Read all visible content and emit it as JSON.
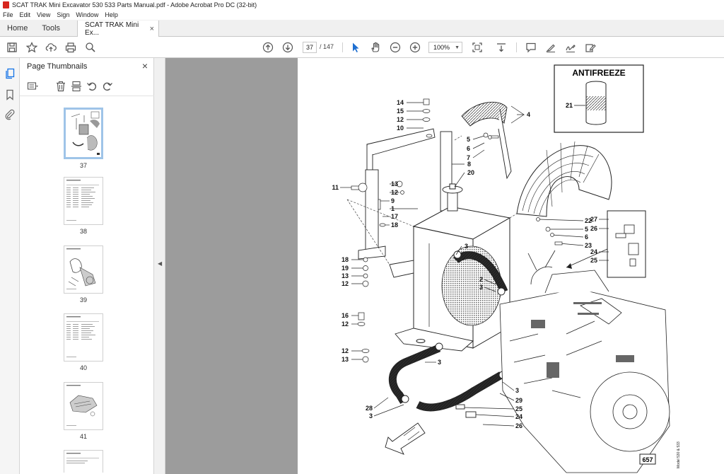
{
  "window": {
    "title": "SCAT TRAK Mini Excavator 530 533 Parts Manual.pdf - Adobe Acrobat Pro DC (32-bit)"
  },
  "menu": [
    "File",
    "Edit",
    "View",
    "Sign",
    "Window",
    "Help"
  ],
  "tabs": {
    "home": "Home",
    "tools": "Tools",
    "document": "SCAT TRAK Mini Ex...",
    "close": "×"
  },
  "toolbar": {
    "icons": [
      "save-icon",
      "star-icon",
      "cloud-upload-icon",
      "print-icon",
      "zoom-search-icon",
      "page-up-icon",
      "page-down-icon",
      "select-cursor-icon",
      "hand-icon",
      "zoom-out-icon",
      "zoom-in-icon",
      "fit-page-icon",
      "scroll-mode-icon",
      "comment-icon",
      "highlight-icon",
      "sign-icon",
      "fill-sign-icon"
    ],
    "current_page": "37",
    "page_separator": "/",
    "total_pages": "147",
    "zoom": "100%"
  },
  "thumbnails": {
    "title": "Page Thumbnails",
    "close": "×",
    "pages": [
      "37",
      "38",
      "39",
      "40",
      "41"
    ],
    "selected": "37"
  },
  "document": {
    "antifreeze_label": "ANTIFREEZE",
    "figure_number": "657",
    "side_note": "Model 530 & 533",
    "callouts": [
      "21",
      "14",
      "15",
      "12",
      "10",
      "4",
      "5",
      "6",
      "7",
      "8",
      "20",
      "11",
      "13",
      "12",
      "9",
      "1",
      "17",
      "18",
      "22",
      "5",
      "6",
      "23",
      "27",
      "26",
      "24",
      "25",
      "3",
      "18",
      "19",
      "13",
      "12",
      "2",
      "3",
      "16",
      "12",
      "12",
      "13",
      "3",
      "3",
      "29",
      "28",
      "3",
      "25",
      "24",
      "26"
    ]
  }
}
